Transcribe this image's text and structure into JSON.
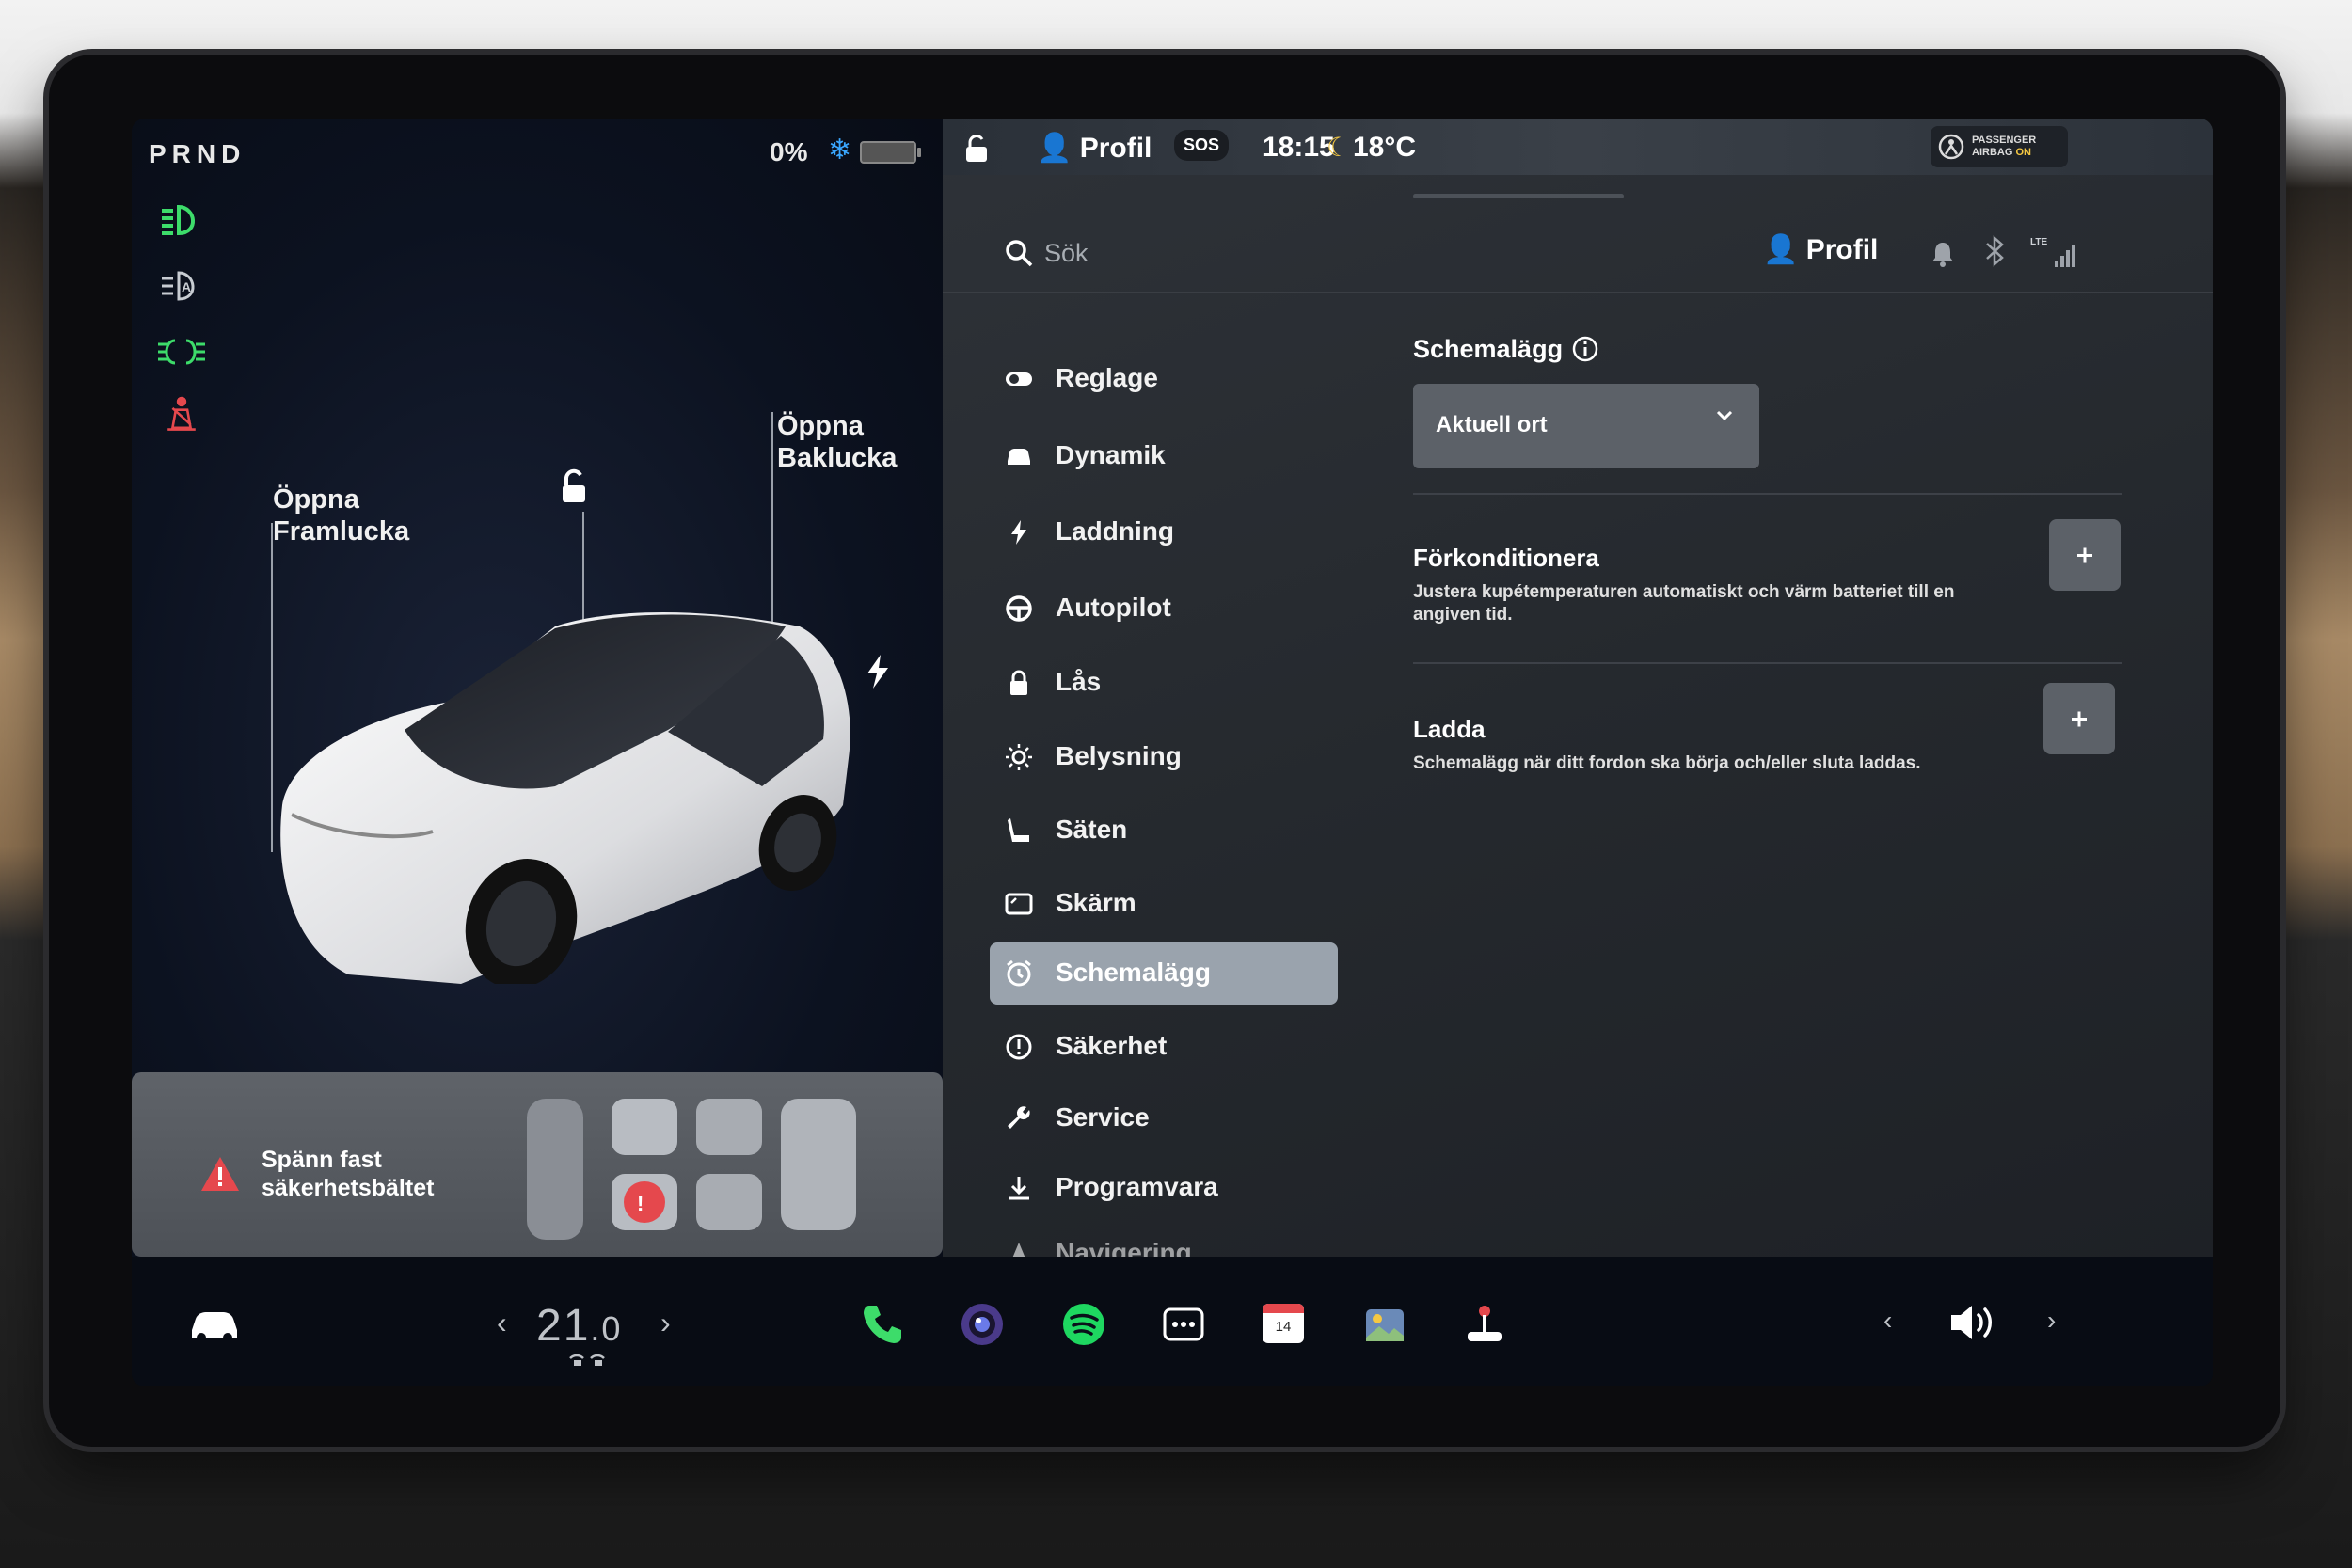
{
  "car": {
    "gear_selector": "PRND",
    "battery_percent": "0%",
    "label_front_trunk": [
      "Öppna",
      "Framlucka"
    ],
    "label_rear_trunk": [
      "Öppna",
      "Baklucka"
    ],
    "seatbelt_alert": [
      "Spänn fast",
      "säkerhetsbältet"
    ]
  },
  "status_bar": {
    "profile_label": "Profil",
    "sos_label": "SOS",
    "time": "18:15",
    "outside_temp": "18°C",
    "airbag_line1": "PASSENGER",
    "airbag_line2": "AIRBAG",
    "airbag_state": "ON"
  },
  "search": {
    "placeholder": "Sök",
    "profile_label": "Profil",
    "lte_label": "LTE"
  },
  "menu": {
    "items": [
      {
        "label": "Reglage",
        "icon": "toggle-icon"
      },
      {
        "label": "Dynamik",
        "icon": "car-front-icon"
      },
      {
        "label": "Laddning",
        "icon": "bolt-icon"
      },
      {
        "label": "Autopilot",
        "icon": "steering-wheel-icon"
      },
      {
        "label": "Lås",
        "icon": "lock-icon"
      },
      {
        "label": "Belysning",
        "icon": "sun-icon"
      },
      {
        "label": "Säten",
        "icon": "seat-icon"
      },
      {
        "label": "Skärm",
        "icon": "screen-icon"
      },
      {
        "label": "Schemalägg",
        "icon": "alarm-clock-icon",
        "active": true
      },
      {
        "label": "Säkerhet",
        "icon": "alert-circle-icon"
      },
      {
        "label": "Service",
        "icon": "wrench-icon"
      },
      {
        "label": "Programvara",
        "icon": "download-icon"
      },
      {
        "label": "Navigering",
        "icon": "navigation-icon"
      }
    ]
  },
  "schedule": {
    "title": "Schemalägg",
    "location_selected": "Aktuell ort",
    "precondition_title": "Förkonditionera",
    "precondition_desc": "Justera kupétemperaturen automatiskt och värm batteriet till en angiven tid.",
    "charge_title": "Ladda",
    "charge_desc": "Schemalägg när ditt fordon ska börja och/eller sluta laddas."
  },
  "bottom_bar": {
    "temp_int": "21",
    "temp_dec": ".0",
    "calendar_day": "14"
  },
  "colors": {
    "accent_blue": "#3aa7ff",
    "headlight_green": "#3ddc6a",
    "seatbelt_red": "#e5484d",
    "active_menu_bg": "#9aa3ad",
    "button_bg": "#5c6168"
  }
}
